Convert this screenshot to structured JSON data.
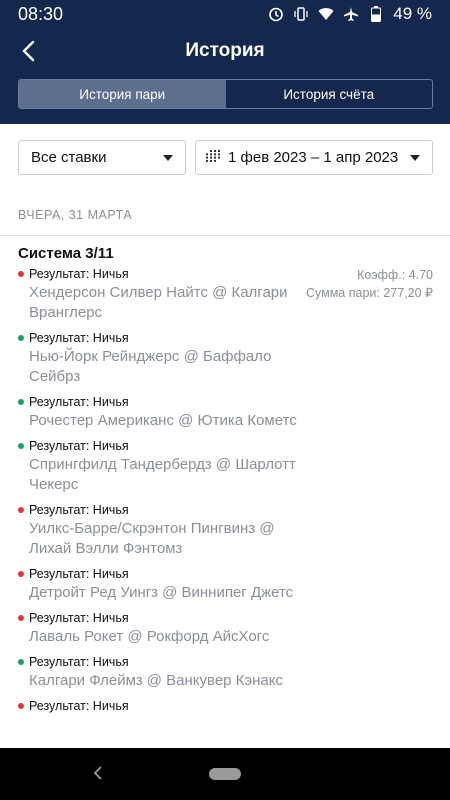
{
  "status_bar": {
    "time": "08:30",
    "battery_text": "49 %",
    "icons": [
      "alarm-icon",
      "vibrate-icon",
      "wifi-icon",
      "airplane-icon",
      "battery-icon"
    ]
  },
  "header": {
    "title": "История",
    "back_icon": "back-arrow-icon",
    "tabs": [
      {
        "label": "История пари",
        "active": true
      },
      {
        "label": "История счёта",
        "active": false
      }
    ]
  },
  "filters": {
    "bet_type": "Все ставки",
    "date_range": "1 фев 2023 – 1 апр 2023",
    "calendar_icon": "calendar-icon"
  },
  "section": {
    "date_label": "ВЧЕРА, 31 МАРТА"
  },
  "bet": {
    "title": "Система 3/11",
    "coeff": "Коэфф.: 4.70",
    "stake": "Сумма пари: 277,20 ₽",
    "events": [
      {
        "status": "red",
        "result": "Результат: Ничья",
        "match": "Хендерсон Силвер Найтс @ Калгари Вранглерс"
      },
      {
        "status": "green",
        "result": "Результат: Ничья",
        "match": "Нью-Йорк Рейнджерс @ Баффало Сейбрз"
      },
      {
        "status": "green",
        "result": "Результат: Ничья",
        "match": "Рочестер Американс @ Ютика Кометс"
      },
      {
        "status": "green",
        "result": "Результат: Ничья",
        "match": "Спрингфилд Тандербердз @ Шарлотт Чекерс"
      },
      {
        "status": "red",
        "result": "Результат: Ничья",
        "match": "Уилкс-Барре/Скрэнтон Пингвинз @ Лихай Вэлли Фэнтомз"
      },
      {
        "status": "red",
        "result": "Результат: Ничья",
        "match": "Детройт Ред Уингз @ Виннипег Джетс"
      },
      {
        "status": "red",
        "result": "Результат: Ничья",
        "match": "Лаваль Рокет @ Рокфорд АйсХогс"
      },
      {
        "status": "green",
        "result": "Результат: Ничья",
        "match": "Калгари Флеймз @ Ванкувер Кэнакс"
      },
      {
        "status": "red",
        "result": "Результат: Ничья",
        "match": ""
      }
    ]
  },
  "colors": {
    "header_bg": "#13284c",
    "active_tab_bg": "#5c6f8f",
    "loss_dot": "#e3343b",
    "win_dot": "#19a05a",
    "muted_text": "#8a8f99"
  }
}
